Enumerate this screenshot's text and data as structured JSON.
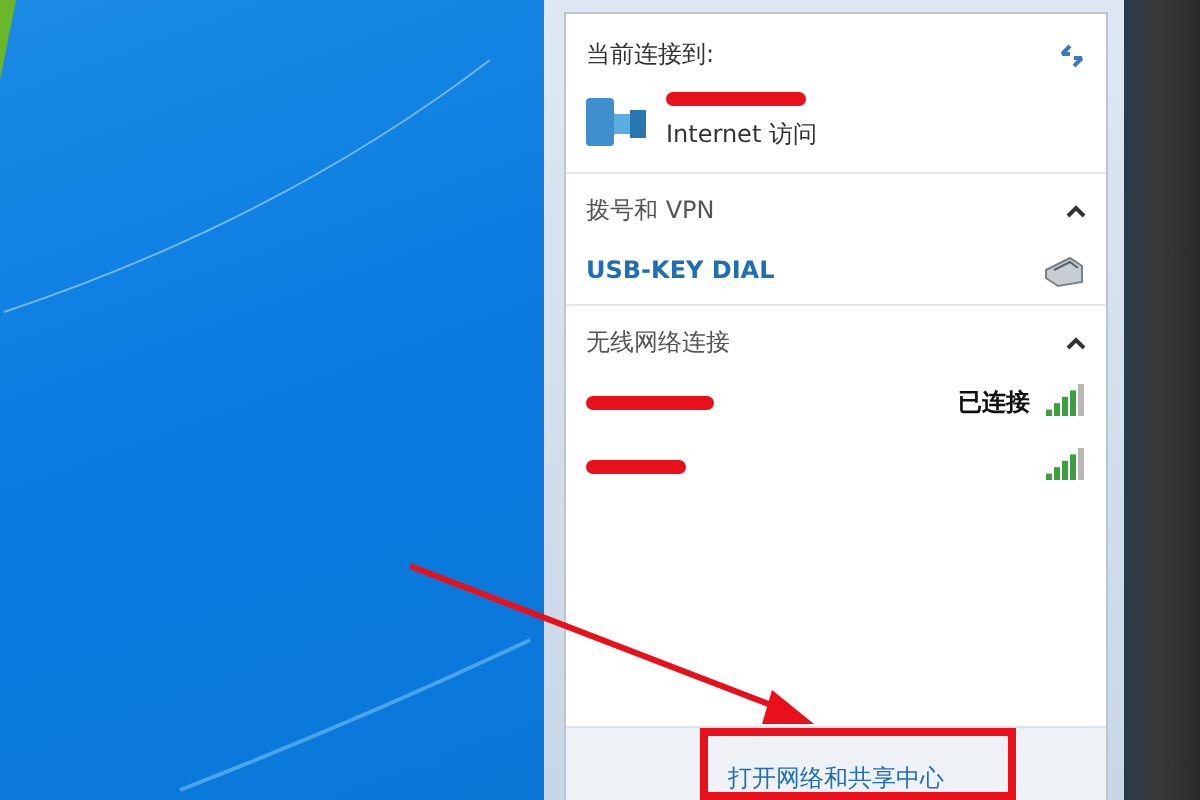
{
  "flyout": {
    "header": "当前连接到:",
    "current_connection": {
      "access": "Internet 访问"
    },
    "sections": [
      {
        "title": "拨号和 VPN",
        "expanded": true,
        "items": [
          {
            "kind": "dialup",
            "name": "USB-KEY DIAL"
          }
        ]
      },
      {
        "title": "无线网络连接",
        "expanded": true,
        "items": [
          {
            "kind": "wifi",
            "status": "已连接"
          },
          {
            "kind": "wifi"
          }
        ]
      }
    ],
    "footer_link": "打开网络和共享中心"
  }
}
